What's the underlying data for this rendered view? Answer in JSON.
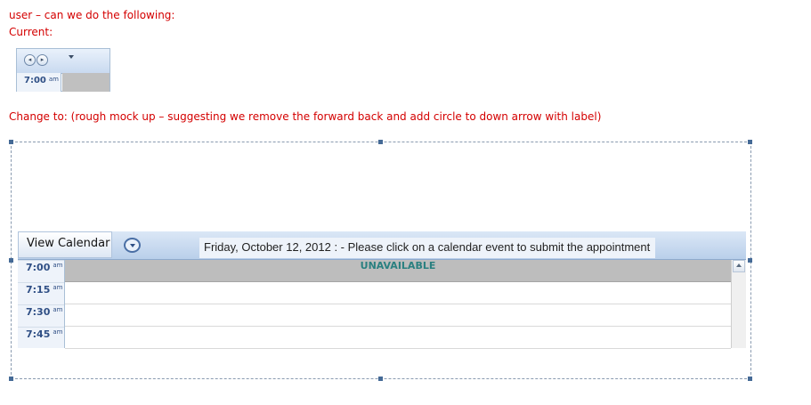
{
  "notes": {
    "line1": "user – can we do the following:",
    "line2": "Current:",
    "line3": "Change to: (rough mock up – suggesting we remove the forward back and add circle to down arrow with label)"
  },
  "current": {
    "back_glyph": "◂",
    "forward_glyph": "▸",
    "time": "7:00",
    "ampm": "am"
  },
  "mockup": {
    "view_calendar_label": "View Calendar",
    "date_label": "Friday, October 12, 2012 : - Please click on a calendar event to submit the appointment",
    "unavailable_label": "UNAVAILABLE",
    "rows": [
      {
        "time": "7:00",
        "ampm": "am"
      },
      {
        "time": "7:15",
        "ampm": "am"
      },
      {
        "time": "7:30",
        "ampm": "am"
      },
      {
        "time": "7:45",
        "ampm": "am"
      }
    ]
  },
  "colors": {
    "note_red": "#d40000",
    "header_blue": "#b9cfea",
    "time_text": "#2f4f85",
    "unavailable_text": "#2a8080",
    "unavailable_bg": "#bdbdbd"
  },
  "icons": {
    "back": "back-arrow-icon",
    "forward": "forward-arrow-icon",
    "dropdown": "chevron-down-icon",
    "down_circle": "circle-down-arrow-icon",
    "scroll_up": "scroll-up-icon"
  }
}
